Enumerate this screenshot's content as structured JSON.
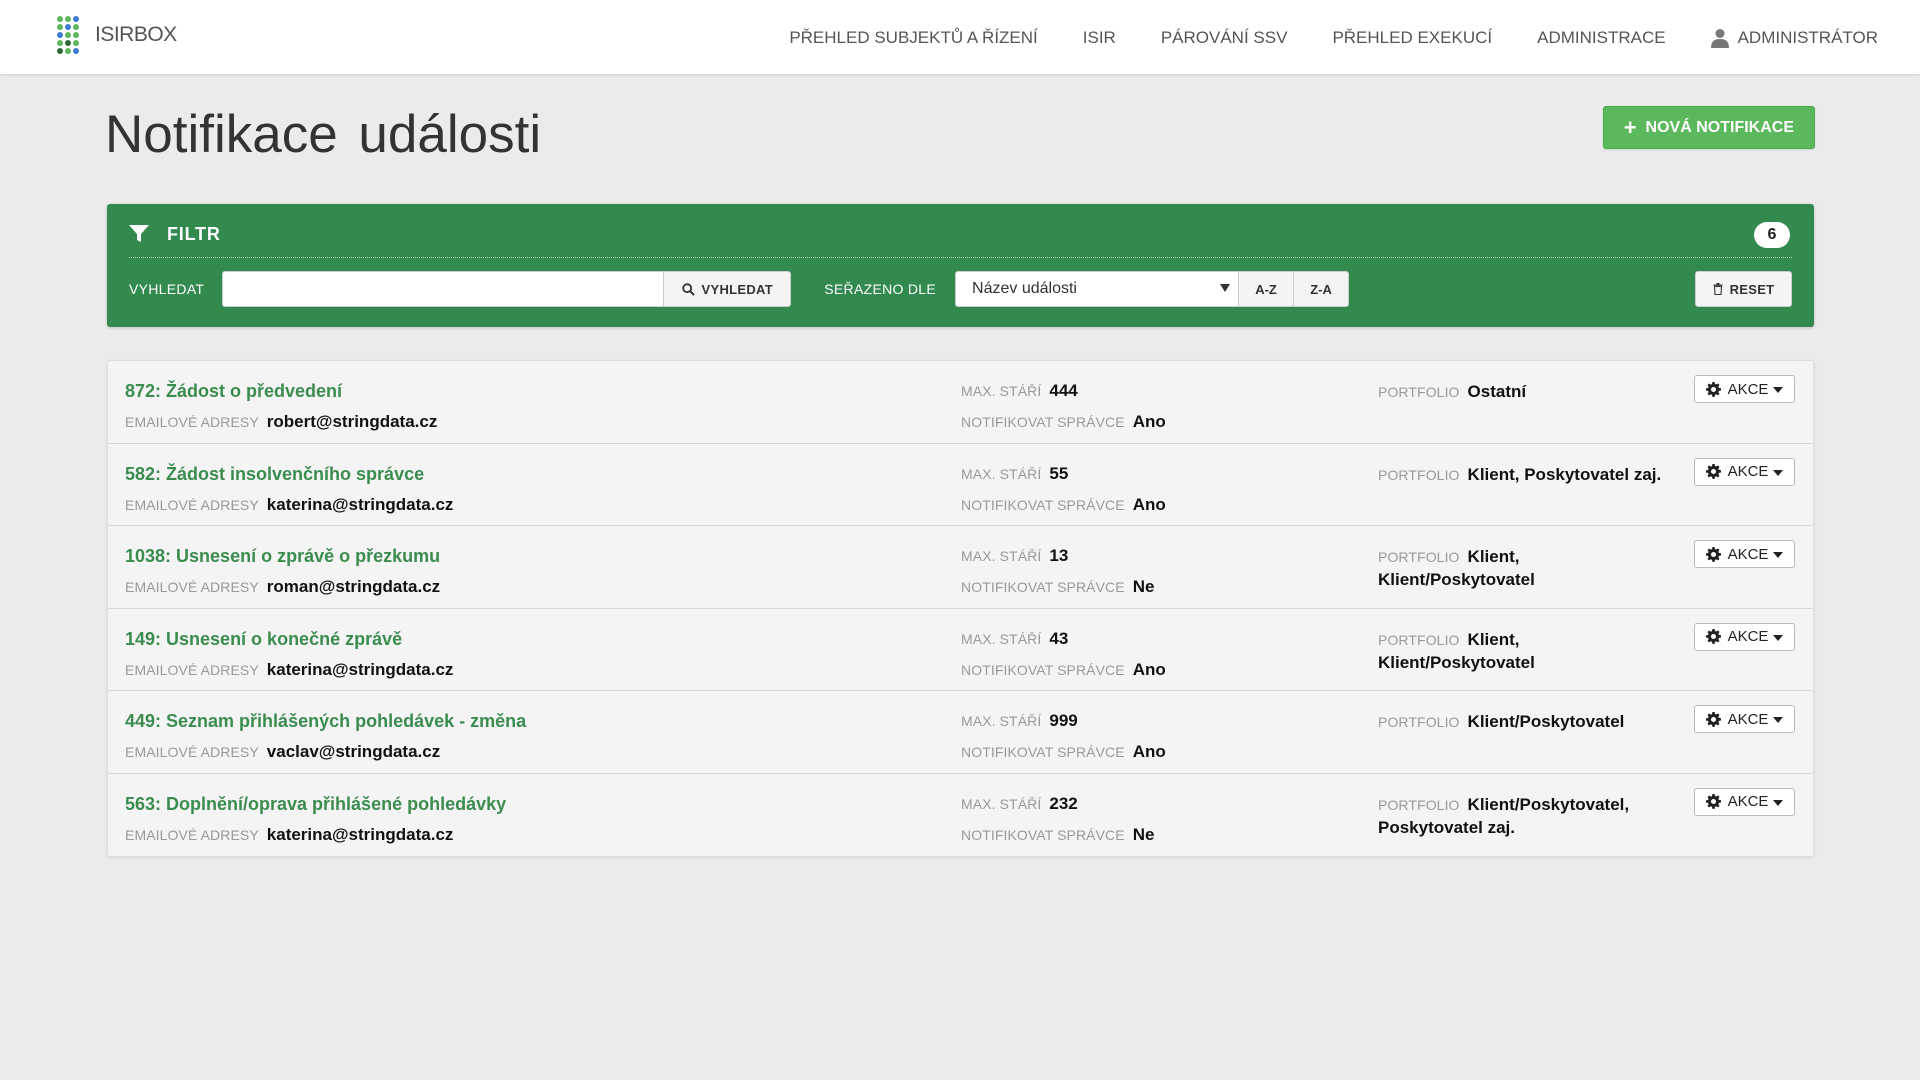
{
  "app": {
    "brand": "ISIRBOX",
    "accent_color": "#328a4e",
    "logo_colors": [
      "#5cb85c",
      "#3a7bd5",
      "#2e6b3a"
    ]
  },
  "nav": {
    "items": [
      {
        "label": "PŘEHLED SUBJEKTŮ A ŘÍZENÍ"
      },
      {
        "label": "ISIR"
      },
      {
        "label": "PÁROVÁNÍ SSV"
      },
      {
        "label": "PŘEHLED EXEKUCÍ"
      },
      {
        "label": "ADMINISTRACE"
      }
    ],
    "user": {
      "label": "ADMINISTRÁTOR",
      "icon": "user-icon"
    }
  },
  "page": {
    "title": "Notifikace události",
    "new_button": "NOVÁ NOTIFIKACE"
  },
  "filter": {
    "title": "FILTR",
    "count": "6",
    "search_label": "VYHLEDAT",
    "search_value": "",
    "search_button": "VYHLEDAT",
    "sort_label": "SEŘAZENO DLE",
    "sort_selected": "Název události",
    "sort_asc": "A-Z",
    "sort_desc": "Z-A",
    "reset": "RESET"
  },
  "labels": {
    "emails": "EMAILOVÉ ADRESY",
    "max_age": "MAX. STÁŘÍ",
    "notify_admin": "NOTIFIKOVAT SPRÁVCE",
    "portfolio": "PORTFOLIO",
    "actions": "AKCE"
  },
  "rows": [
    {
      "title": "872: Žádost o předvedení",
      "email": "robert@stringdata.cz",
      "max_age": "444",
      "notify": "Ano",
      "portfolio": "Ostatní"
    },
    {
      "title": "582: Žádost insolvenčního správce",
      "email": "katerina@stringdata.cz",
      "max_age": "55",
      "notify": "Ano",
      "portfolio": "Klient, Poskytovatel zaj."
    },
    {
      "title": "1038: Usnesení o zprávě o přezkumu",
      "email": "roman@stringdata.cz",
      "max_age": "13",
      "notify": "Ne",
      "portfolio": "Klient, Klient/Poskytovatel"
    },
    {
      "title": "149: Usnesení o konečné zprávě",
      "email": "katerina@stringdata.cz",
      "max_age": "43",
      "notify": "Ano",
      "portfolio": "Klient, Klient/Poskytovatel"
    },
    {
      "title": "449: Seznam přihlášených pohledávek - změna",
      "email": "vaclav@stringdata.cz",
      "max_age": "999",
      "notify": "Ano",
      "portfolio": "Klient/Poskytovatel"
    },
    {
      "title": "563: Doplnění/oprava přihlášené pohledávky",
      "email": "katerina@stringdata.cz",
      "max_age": "232",
      "notify": "Ne",
      "portfolio": "Klient/Poskytovatel, Poskytovatel zaj."
    }
  ]
}
